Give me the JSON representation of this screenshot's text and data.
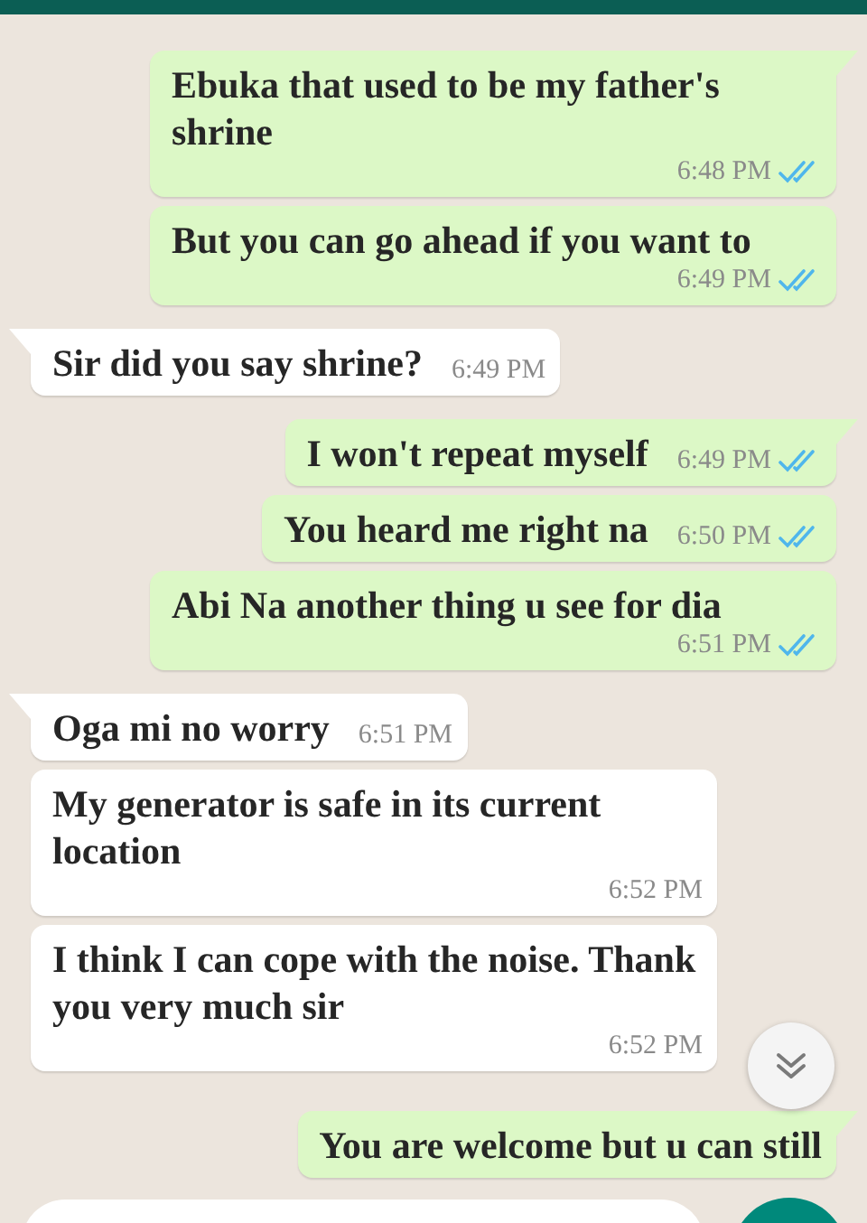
{
  "messages": [
    {
      "kind": "outgoing",
      "tail": true,
      "text": "Ebuka that used to be my father's shrine",
      "time": "6:48 PM",
      "read": true
    },
    {
      "kind": "outgoing",
      "tail": false,
      "text": "But you can go ahead if you want to",
      "time": "6:49 PM",
      "read": true
    },
    {
      "kind": "incoming",
      "tail": true,
      "text": "Sir did you say shrine?",
      "time": "6:49 PM"
    },
    {
      "kind": "outgoing",
      "tail": true,
      "text": "I won't repeat myself",
      "time": "6:49 PM",
      "read": true
    },
    {
      "kind": "outgoing",
      "tail": false,
      "text": "You heard me right na",
      "time": "6:50 PM",
      "read": true
    },
    {
      "kind": "outgoing",
      "tail": false,
      "text": "Abi Na another thing u see for dia",
      "time": "6:51 PM",
      "read": true
    },
    {
      "kind": "incoming",
      "tail": true,
      "text": "Oga mi no worry",
      "time": "6:51 PM"
    },
    {
      "kind": "incoming",
      "tail": false,
      "text": "My generator is safe in its current location",
      "time": "6:52 PM"
    },
    {
      "kind": "incoming",
      "tail": false,
      "text": "I think I can cope with the noise. Thank you very much sir",
      "time": "6:52 PM"
    },
    {
      "kind": "outgoing",
      "tail": true,
      "text": "You are welcome but u can still"
    }
  ]
}
